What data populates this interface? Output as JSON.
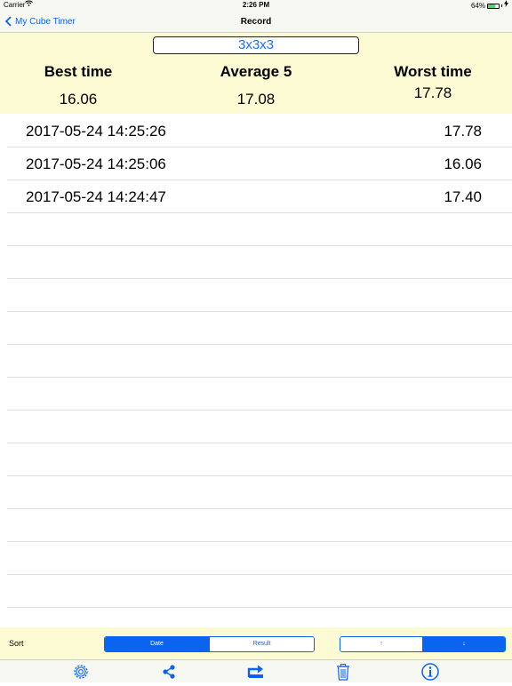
{
  "status_bar": {
    "carrier": "Carrier",
    "time": "2:26 PM",
    "battery": "64%",
    "battery_level": 0.64
  },
  "nav": {
    "back_label": "My Cube Timer",
    "title": "Record"
  },
  "summary": {
    "puzzle": "3x3x3",
    "best_label": "Best time",
    "best_value": "16.06",
    "average_label": "Average 5",
    "average_value": "17.08",
    "worst_label": "Worst time",
    "worst_value": "17.78"
  },
  "records": [
    {
      "date": "2017-05-24 14:25:26",
      "time": "17.78"
    },
    {
      "date": "2017-05-24 14:25:06",
      "time": "16.06"
    },
    {
      "date": "2017-05-24 14:24:47",
      "time": "17.40"
    }
  ],
  "sort": {
    "label": "Sort",
    "by_options": [
      "Date",
      "Result"
    ],
    "by_selected": "Date",
    "order_options": [
      "↑",
      "↓"
    ],
    "order_selected": "↓"
  },
  "toolbar": {
    "icons": [
      "gear-icon",
      "share-icon",
      "export-icon",
      "trash-icon",
      "info-icon"
    ]
  },
  "colors": {
    "accent": "#0a64f0",
    "summary_bg": "#fdfbd3",
    "battery": "#4cd964"
  }
}
